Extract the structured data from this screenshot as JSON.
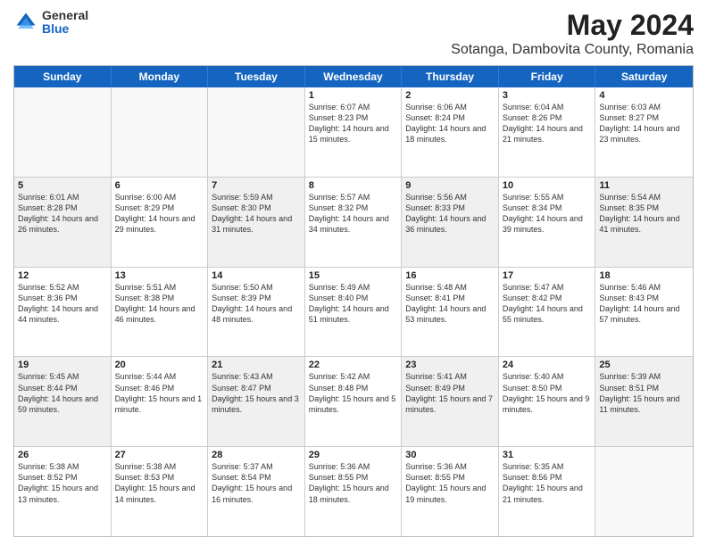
{
  "logo": {
    "general": "General",
    "blue": "Blue"
  },
  "title": "May 2024",
  "subtitle": "Sotanga, Dambovita County, Romania",
  "header_days": [
    "Sunday",
    "Monday",
    "Tuesday",
    "Wednesday",
    "Thursday",
    "Friday",
    "Saturday"
  ],
  "weeks": [
    [
      {
        "day": "",
        "empty": true,
        "shaded": false
      },
      {
        "day": "",
        "empty": true,
        "shaded": false
      },
      {
        "day": "",
        "empty": true,
        "shaded": false
      },
      {
        "day": "1",
        "sunrise": "6:07 AM",
        "sunset": "8:23 PM",
        "daylight": "14 hours and 15 minutes."
      },
      {
        "day": "2",
        "sunrise": "6:06 AM",
        "sunset": "8:24 PM",
        "daylight": "14 hours and 18 minutes."
      },
      {
        "day": "3",
        "sunrise": "6:04 AM",
        "sunset": "8:26 PM",
        "daylight": "14 hours and 21 minutes."
      },
      {
        "day": "4",
        "sunrise": "6:03 AM",
        "sunset": "8:27 PM",
        "daylight": "14 hours and 23 minutes."
      }
    ],
    [
      {
        "day": "5",
        "sunrise": "6:01 AM",
        "sunset": "8:28 PM",
        "daylight": "14 hours and 26 minutes."
      },
      {
        "day": "6",
        "sunrise": "6:00 AM",
        "sunset": "8:29 PM",
        "daylight": "14 hours and 29 minutes."
      },
      {
        "day": "7",
        "sunrise": "5:59 AM",
        "sunset": "8:30 PM",
        "daylight": "14 hours and 31 minutes."
      },
      {
        "day": "8",
        "sunrise": "5:57 AM",
        "sunset": "8:32 PM",
        "daylight": "14 hours and 34 minutes."
      },
      {
        "day": "9",
        "sunrise": "5:56 AM",
        "sunset": "8:33 PM",
        "daylight": "14 hours and 36 minutes."
      },
      {
        "day": "10",
        "sunrise": "5:55 AM",
        "sunset": "8:34 PM",
        "daylight": "14 hours and 39 minutes."
      },
      {
        "day": "11",
        "sunrise": "5:54 AM",
        "sunset": "8:35 PM",
        "daylight": "14 hours and 41 minutes."
      }
    ],
    [
      {
        "day": "12",
        "sunrise": "5:52 AM",
        "sunset": "8:36 PM",
        "daylight": "14 hours and 44 minutes."
      },
      {
        "day": "13",
        "sunrise": "5:51 AM",
        "sunset": "8:38 PM",
        "daylight": "14 hours and 46 minutes."
      },
      {
        "day": "14",
        "sunrise": "5:50 AM",
        "sunset": "8:39 PM",
        "daylight": "14 hours and 48 minutes."
      },
      {
        "day": "15",
        "sunrise": "5:49 AM",
        "sunset": "8:40 PM",
        "daylight": "14 hours and 51 minutes."
      },
      {
        "day": "16",
        "sunrise": "5:48 AM",
        "sunset": "8:41 PM",
        "daylight": "14 hours and 53 minutes."
      },
      {
        "day": "17",
        "sunrise": "5:47 AM",
        "sunset": "8:42 PM",
        "daylight": "14 hours and 55 minutes."
      },
      {
        "day": "18",
        "sunrise": "5:46 AM",
        "sunset": "8:43 PM",
        "daylight": "14 hours and 57 minutes."
      }
    ],
    [
      {
        "day": "19",
        "sunrise": "5:45 AM",
        "sunset": "8:44 PM",
        "daylight": "14 hours and 59 minutes."
      },
      {
        "day": "20",
        "sunrise": "5:44 AM",
        "sunset": "8:46 PM",
        "daylight": "15 hours and 1 minute."
      },
      {
        "day": "21",
        "sunrise": "5:43 AM",
        "sunset": "8:47 PM",
        "daylight": "15 hours and 3 minutes."
      },
      {
        "day": "22",
        "sunrise": "5:42 AM",
        "sunset": "8:48 PM",
        "daylight": "15 hours and 5 minutes."
      },
      {
        "day": "23",
        "sunrise": "5:41 AM",
        "sunset": "8:49 PM",
        "daylight": "15 hours and 7 minutes."
      },
      {
        "day": "24",
        "sunrise": "5:40 AM",
        "sunset": "8:50 PM",
        "daylight": "15 hours and 9 minutes."
      },
      {
        "day": "25",
        "sunrise": "5:39 AM",
        "sunset": "8:51 PM",
        "daylight": "15 hours and 11 minutes."
      }
    ],
    [
      {
        "day": "26",
        "sunrise": "5:38 AM",
        "sunset": "8:52 PM",
        "daylight": "15 hours and 13 minutes."
      },
      {
        "day": "27",
        "sunrise": "5:38 AM",
        "sunset": "8:53 PM",
        "daylight": "15 hours and 14 minutes."
      },
      {
        "day": "28",
        "sunrise": "5:37 AM",
        "sunset": "8:54 PM",
        "daylight": "15 hours and 16 minutes."
      },
      {
        "day": "29",
        "sunrise": "5:36 AM",
        "sunset": "8:55 PM",
        "daylight": "15 hours and 18 minutes."
      },
      {
        "day": "30",
        "sunrise": "5:36 AM",
        "sunset": "8:55 PM",
        "daylight": "15 hours and 19 minutes."
      },
      {
        "day": "31",
        "sunrise": "5:35 AM",
        "sunset": "8:56 PM",
        "daylight": "15 hours and 21 minutes."
      },
      {
        "day": "",
        "empty": true,
        "shaded": false
      }
    ]
  ]
}
